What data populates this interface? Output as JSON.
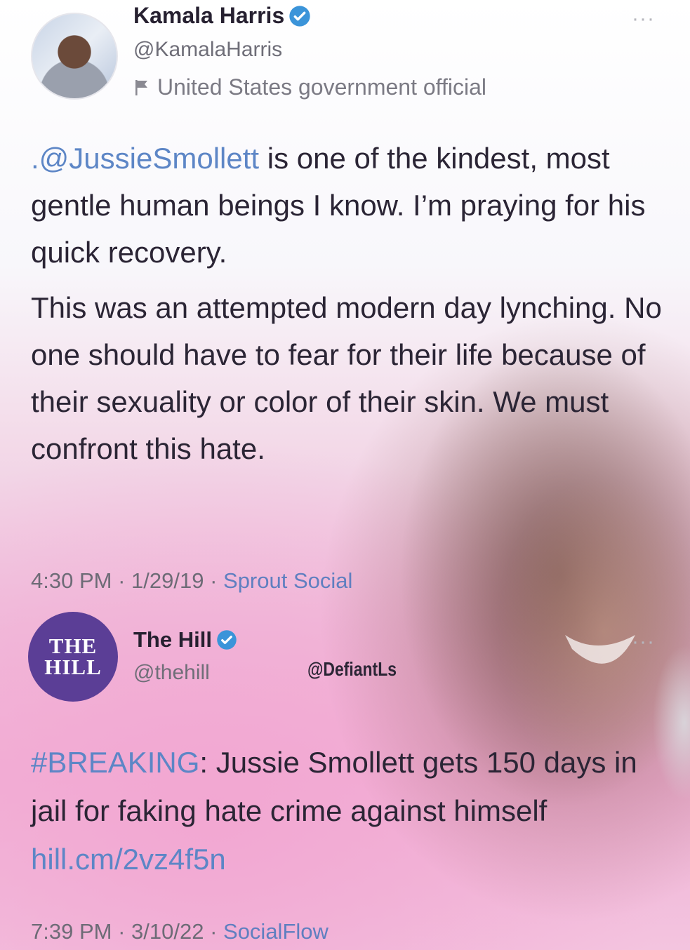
{
  "tweet_harris": {
    "display_name": "Kamala Harris",
    "handle": "@KamalaHarris",
    "label": "United States government official",
    "mention": ".@JussieSmollett",
    "para1_rest": " is one of the kindest, most gentle human beings I know. I’m praying for his quick recovery.",
    "para2": "This was an attempted modern day lynching. No one should have to fear for their life because of their sexuality or color of their skin. We must confront this hate.",
    "time": "4:30 PM",
    "date": "1/29/19",
    "source": "Sprout Social"
  },
  "tweet_hill": {
    "avatar_line1": "THE",
    "avatar_line2": "HILL",
    "display_name": "The Hill",
    "handle": "@thehill",
    "hashtag": "#BREAKING",
    "text_rest": ": Jussie Smollett gets 150 days in jail for faking hate crime against himself ",
    "link": "hill.cm/2vz4f5n",
    "time": "7:39 PM",
    "date": "3/10/22",
    "source": "SocialFlow"
  },
  "watermark": "@DefiantLs",
  "separator": " · ",
  "more_glyph": "···",
  "colors": {
    "link_blue": "#5d86c6",
    "verified_blue": "#3b94d9",
    "hill_purple": "#5b3e96"
  },
  "icons": [
    "verified-badge-icon",
    "flag-icon",
    "more-options-icon"
  ]
}
